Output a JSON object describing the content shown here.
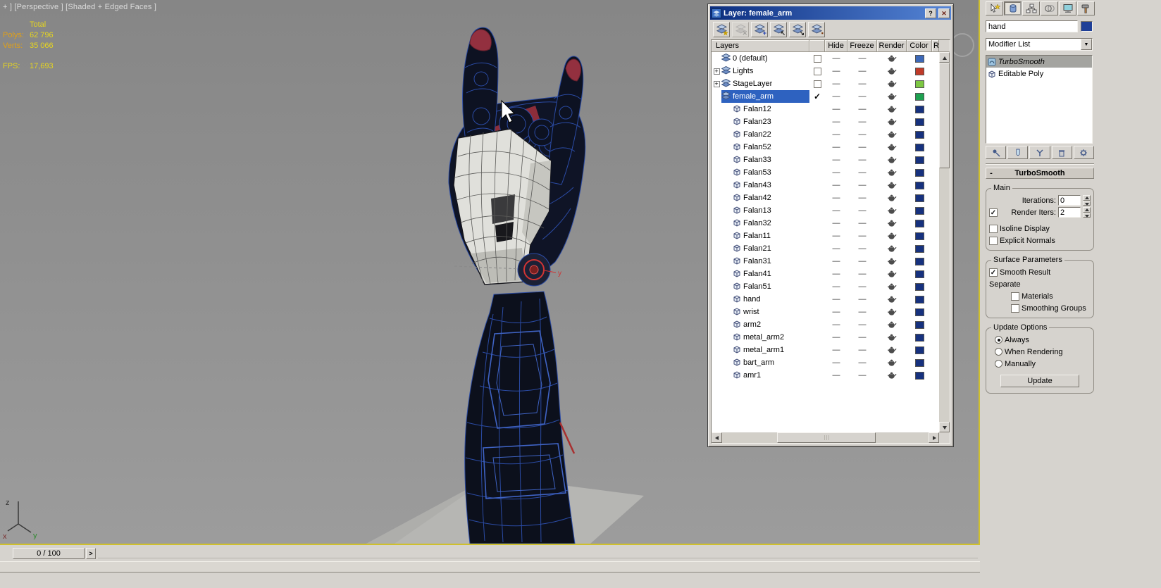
{
  "viewport": {
    "label": "+ ] [Perspective ] [Shaded + Edged Faces ]",
    "stats": {
      "total_label": "Total",
      "polys_label": "Polys:",
      "polys_value": "62 796",
      "verts_label": "Verts:",
      "verts_value": "35 066",
      "fps_label": "FPS:",
      "fps_value": "17,693"
    },
    "axis": {
      "z": "z",
      "y": "y",
      "x": "x"
    },
    "gizmo_axis_label": "y"
  },
  "timeline": {
    "frame_display": "0 / 100",
    "next_frame_button": ">"
  },
  "layer_dialog": {
    "title": "Layer: female_arm",
    "help_button": "?",
    "close_button": "✕",
    "toolbar_icons": [
      "new-layer-icon",
      "delete-layer-icon",
      "add-selected-to-layer-icon",
      "select-layer-objects-icon",
      "highlight-selected-objects-layer-icon",
      "edit-layer-properties-icon"
    ],
    "columns": {
      "layers": "Layers",
      "hide": "Hide",
      "freeze": "Freeze",
      "render": "Render",
      "color": "Color",
      "radiosity": "Ra"
    },
    "expand_glyph": "+",
    "current_mark": "✓",
    "hide_freeze_placeholder": "—",
    "rows": [
      {
        "kind": "layer",
        "name": "0 (default)",
        "expand": false,
        "current": false,
        "color": "#3c68b8"
      },
      {
        "kind": "layer",
        "name": "Lights",
        "expand": true,
        "current": false,
        "color": "#c03a28"
      },
      {
        "kind": "layer",
        "name": "StageLayer",
        "expand": true,
        "current": false,
        "color": "#7cc742"
      },
      {
        "kind": "layer",
        "name": "female_arm",
        "expand": false,
        "current": true,
        "selected": true,
        "color": "#1da150"
      },
      {
        "kind": "object",
        "name": "Falan12",
        "color": "#16317e"
      },
      {
        "kind": "object",
        "name": "Falan23",
        "color": "#16317e"
      },
      {
        "kind": "object",
        "name": "Falan22",
        "color": "#16317e"
      },
      {
        "kind": "object",
        "name": "Falan52",
        "color": "#16317e"
      },
      {
        "kind": "object",
        "name": "Falan33",
        "color": "#16317e"
      },
      {
        "kind": "object",
        "name": "Falan53",
        "color": "#16317e"
      },
      {
        "kind": "object",
        "name": "Falan43",
        "color": "#16317e"
      },
      {
        "kind": "object",
        "name": "Falan42",
        "color": "#16317e"
      },
      {
        "kind": "object",
        "name": "Falan13",
        "color": "#16317e"
      },
      {
        "kind": "object",
        "name": "Falan32",
        "color": "#16317e"
      },
      {
        "kind": "object",
        "name": "Falan11",
        "color": "#16317e"
      },
      {
        "kind": "object",
        "name": "Falan21",
        "color": "#16317e"
      },
      {
        "kind": "object",
        "name": "Falan31",
        "color": "#16317e"
      },
      {
        "kind": "object",
        "name": "Falan41",
        "color": "#16317e"
      },
      {
        "kind": "object",
        "name": "Falan51",
        "color": "#16317e"
      },
      {
        "kind": "object",
        "name": "hand",
        "color": "#16317e"
      },
      {
        "kind": "object",
        "name": "wrist",
        "color": "#16317e"
      },
      {
        "kind": "object",
        "name": "arm2",
        "color": "#16317e"
      },
      {
        "kind": "object",
        "name": "metal_arm2",
        "color": "#16317e"
      },
      {
        "kind": "object",
        "name": "metal_arm1",
        "color": "#16317e"
      },
      {
        "kind": "object",
        "name": "bart_arm",
        "color": "#16317e"
      },
      {
        "kind": "object",
        "name": "amr1",
        "color": "#16317e"
      }
    ]
  },
  "command_panel": {
    "tab_icons": [
      "create-icon",
      "modify-icon",
      "hierarchy-icon",
      "motion-icon",
      "display-icon",
      "utilities-icon"
    ],
    "active_tab": "modify",
    "object_name": "hand",
    "object_color": "#1f3f97",
    "modifier_list_label": "Modifier List",
    "modifier_stack": [
      {
        "label": "TurboSmooth",
        "selected": true
      },
      {
        "label": "Editable Poly",
        "selected": false
      }
    ],
    "stack_button_icons": [
      "pin-stack-icon",
      "show-end-result-icon",
      "make-unique-icon",
      "remove-modifier-icon",
      "configure-modifier-sets-icon"
    ],
    "rollout": {
      "collapse_glyph": "-",
      "title": "TurboSmooth",
      "main": {
        "title": "Main",
        "iterations_label": "Iterations:",
        "iterations_value": "0",
        "render_iters_label": "Render Iters:",
        "render_iters_checked": true,
        "render_iters_value": "2",
        "isoline_display_label": "Isoline Display",
        "explicit_normals_label": "Explicit Normals"
      },
      "surface": {
        "title": "Surface Parameters",
        "smooth_result_label": "Smooth Result",
        "smooth_result_checked": true,
        "separate_label": "Separate",
        "materials_label": "Materials",
        "smoothing_groups_label": "Smoothing Groups"
      },
      "update": {
        "title": "Update Options",
        "always_label": "Always",
        "when_rendering_label": "When Rendering",
        "manually_label": "Manually",
        "selected": "Always",
        "update_button": "Update"
      }
    }
  },
  "colors": {
    "active_viewport_border": "#cfc02c",
    "selected_row": "#2e62c0",
    "stats_label": "#e0a018",
    "stats_value": "#e6d51f"
  }
}
